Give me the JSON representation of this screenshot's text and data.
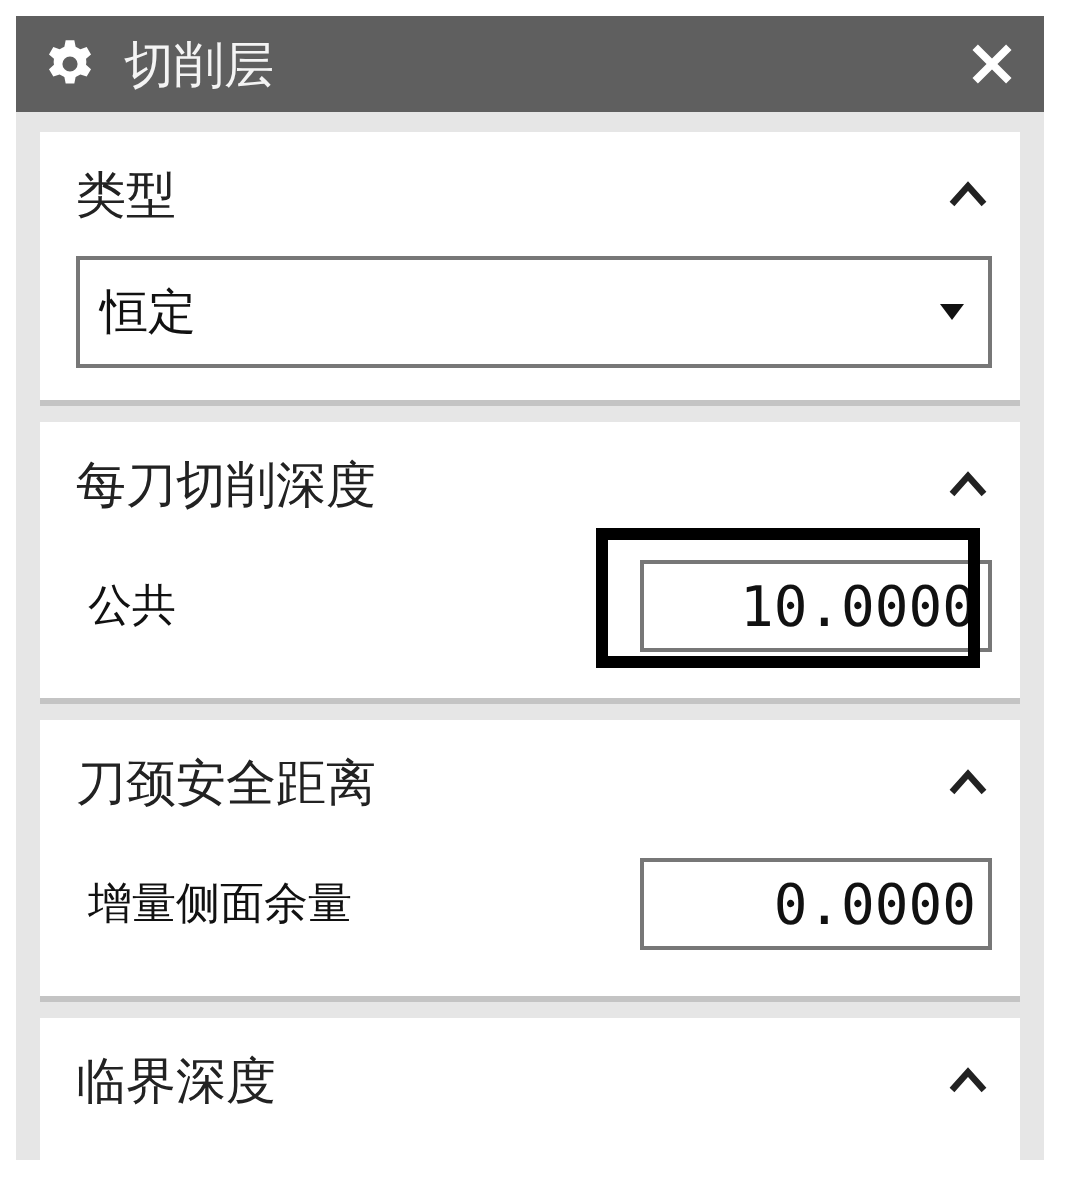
{
  "window": {
    "title": "切削层"
  },
  "sections": [
    {
      "title": "类型",
      "expanded": true,
      "rows": [
        {
          "kind": "dropdown",
          "value": "恒定"
        }
      ]
    },
    {
      "title": "每刀切削深度",
      "expanded": true,
      "rows": [
        {
          "kind": "field",
          "label": "公共",
          "value": "10.0000",
          "highlighted": true
        }
      ]
    },
    {
      "title": "刀颈安全距离",
      "expanded": true,
      "rows": [
        {
          "kind": "field",
          "label": "增量侧面余量",
          "value": "0.0000",
          "highlighted": false
        }
      ]
    },
    {
      "title": "临界深度",
      "expanded": true
    }
  ]
}
